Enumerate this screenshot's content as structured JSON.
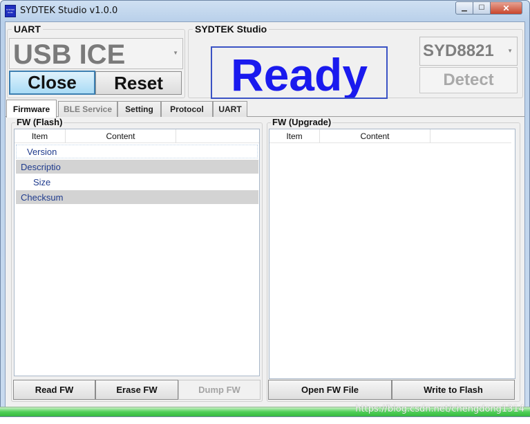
{
  "window": {
    "title": "SYDTEK Studio v1.0.0",
    "icon_text": "SYDTEK studio",
    "controls": {
      "minimize": "▁",
      "maximize": "☐",
      "close": "✕"
    }
  },
  "uart_group": {
    "title": "UART",
    "port_select": "USB ICE",
    "close_label": "Close",
    "reset_label": "Reset"
  },
  "studio_group": {
    "title": "SYDTEK Studio",
    "status": "Ready",
    "device_select": "SYD8821",
    "detect_label": "Detect"
  },
  "tabs": [
    {
      "label": "Firmware",
      "state": "active"
    },
    {
      "label": "BLE Service",
      "state": "disabled"
    },
    {
      "label": "Setting",
      "state": "normal"
    },
    {
      "label": "Protocol",
      "state": "normal"
    },
    {
      "label": "UART",
      "state": "normal"
    }
  ],
  "fw_flash": {
    "title": "FW (Flash)",
    "columns": [
      "Item",
      "Content"
    ],
    "rows": [
      "Version",
      "Descriptio",
      "Size",
      "Checksum"
    ],
    "buttons": {
      "read": "Read FW",
      "erase": "Erase FW",
      "dump": "Dump FW"
    }
  },
  "fw_upgrade": {
    "title": "FW (Upgrade)",
    "columns": [
      "Item",
      "Content"
    ],
    "buttons": {
      "open": "Open FW File",
      "write": "Write to Flash"
    }
  },
  "progress": {
    "value_percent": 100
  },
  "watermark": "https://blog.csdn.net/chengdong1314",
  "colors": {
    "ready_text": "#1a1aee",
    "progress": "#4fcf58",
    "title_bar": "#c9dbef"
  }
}
